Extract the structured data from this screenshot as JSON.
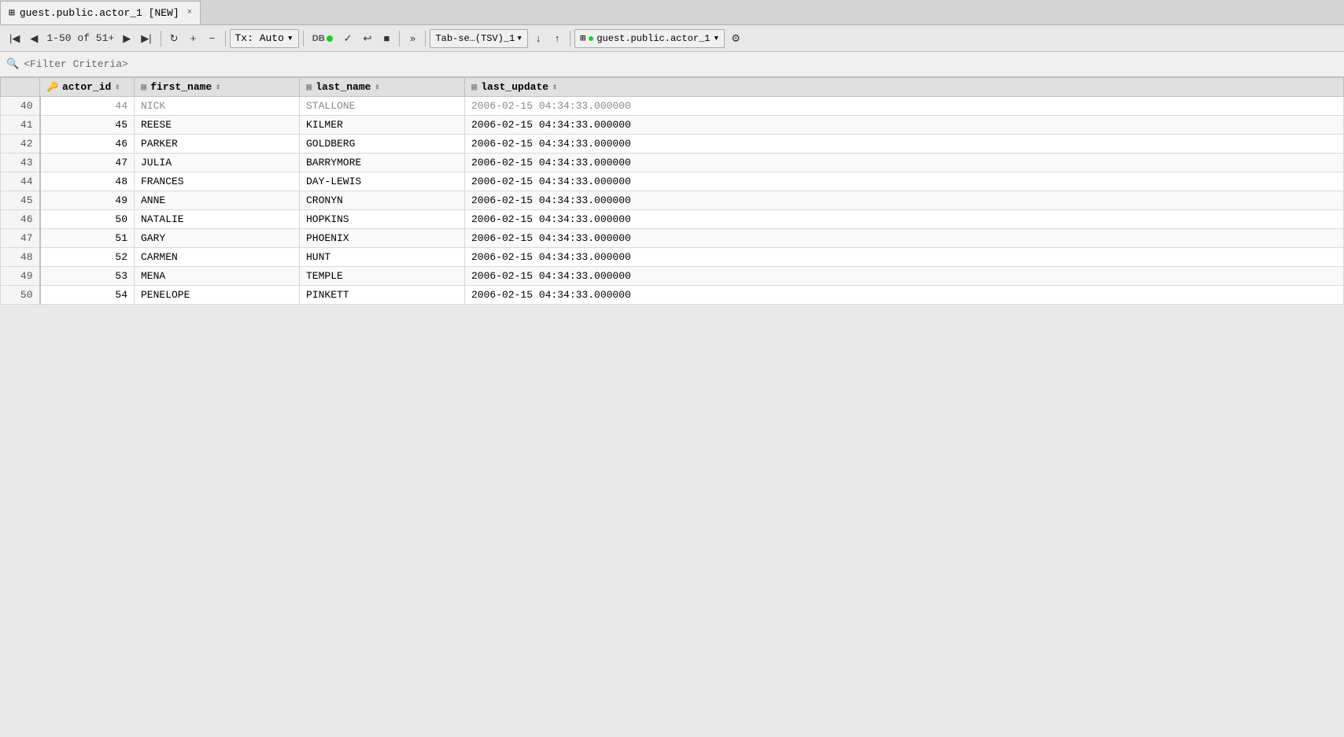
{
  "tab": {
    "icon": "grid-icon",
    "label": "guest.public.actor_1 [NEW]",
    "close_label": "×"
  },
  "toolbar": {
    "nav_first": "|◀",
    "nav_prev": "◀",
    "page_range": "1-50",
    "page_of": "of 51+",
    "nav_next": "▶",
    "nav_last": "▶|",
    "refresh": "↻",
    "add_row": "+",
    "del_row": "−",
    "tx_label": "Tx: Auto",
    "tx_dropdown_arrow": "▾",
    "db_icon": "DB",
    "check": "✓",
    "rollback": "↩",
    "stop": "■",
    "more": "»",
    "export_label": "Tab-se…(TSV)_1",
    "export_dropdown_arrow": "▾",
    "download": "↓",
    "upload": "↑",
    "table_label": "guest.public.actor_1",
    "table_dropdown_arrow": "▾",
    "settings": "⚙"
  },
  "filter": {
    "icon": "🔍",
    "placeholder": "<Filter Criteria>"
  },
  "columns": [
    {
      "id": "row_num",
      "label": "",
      "icon": ""
    },
    {
      "id": "actor_id",
      "label": "actor_id",
      "icon": "key"
    },
    {
      "id": "first_name",
      "label": "first_name",
      "icon": "col"
    },
    {
      "id": "last_name",
      "label": "last_name",
      "icon": "col"
    },
    {
      "id": "last_update",
      "label": "last_update",
      "icon": "col"
    }
  ],
  "partial_row": {
    "row_num": "40",
    "actor_id": "44",
    "first_name": "NICK",
    "last_name": "STALLONE",
    "last_update": "2006-02-15 04:34:33.000000"
  },
  "rows": [
    {
      "row_num": "41",
      "actor_id": "45",
      "first_name": "REESE",
      "last_name": "KILMER",
      "last_update": "2006-02-15 04:34:33.000000"
    },
    {
      "row_num": "42",
      "actor_id": "46",
      "first_name": "PARKER",
      "last_name": "GOLDBERG",
      "last_update": "2006-02-15 04:34:33.000000"
    },
    {
      "row_num": "43",
      "actor_id": "47",
      "first_name": "JULIA",
      "last_name": "BARRYMORE",
      "last_update": "2006-02-15 04:34:33.000000"
    },
    {
      "row_num": "44",
      "actor_id": "48",
      "first_name": "FRANCES",
      "last_name": "DAY-LEWIS",
      "last_update": "2006-02-15 04:34:33.000000"
    },
    {
      "row_num": "45",
      "actor_id": "49",
      "first_name": "ANNE",
      "last_name": "CRONYN",
      "last_update": "2006-02-15 04:34:33.000000"
    },
    {
      "row_num": "46",
      "actor_id": "50",
      "first_name": "NATALIE",
      "last_name": "HOPKINS",
      "last_update": "2006-02-15 04:34:33.000000"
    },
    {
      "row_num": "47",
      "actor_id": "51",
      "first_name": "GARY",
      "last_name": "PHOENIX",
      "last_update": "2006-02-15 04:34:33.000000"
    },
    {
      "row_num": "48",
      "actor_id": "52",
      "first_name": "CARMEN",
      "last_name": "HUNT",
      "last_update": "2006-02-15 04:34:33.000000"
    },
    {
      "row_num": "49",
      "actor_id": "53",
      "first_name": "MENA",
      "last_name": "TEMPLE",
      "last_update": "2006-02-15 04:34:33.000000"
    },
    {
      "row_num": "50",
      "actor_id": "54",
      "first_name": "PENELOPE",
      "last_name": "PINKETT",
      "last_update": "2006-02-15 04:34:33.000000"
    }
  ]
}
